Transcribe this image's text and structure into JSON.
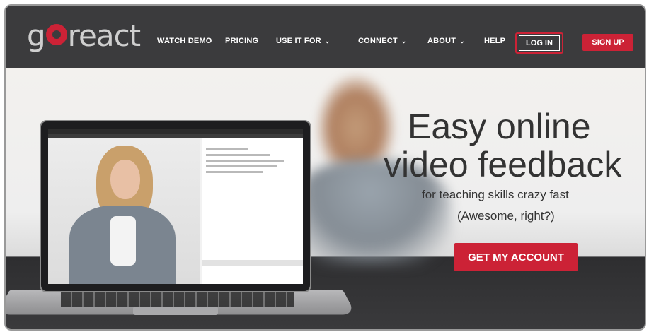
{
  "logo": {
    "pre": "g",
    "post": "react"
  },
  "nav": {
    "items": [
      {
        "label": "WATCH DEMO",
        "dropdown": false
      },
      {
        "label": "PRICING",
        "dropdown": false
      },
      {
        "label": "USE IT FOR",
        "dropdown": true
      },
      {
        "label": "CONNECT",
        "dropdown": true
      },
      {
        "label": "ABOUT",
        "dropdown": true
      },
      {
        "label": "HELP",
        "dropdown": false
      }
    ],
    "login_label": "LOG IN",
    "signup_label": "SIGN UP",
    "chevron": "⌄"
  },
  "hero": {
    "headline_line1": "Easy online",
    "headline_line2": "video feedback",
    "subtitle_line1": "for teaching skills crazy fast",
    "subtitle_line2": "(Awesome, right?)",
    "cta_label": "GET MY ACCOUNT"
  },
  "colors": {
    "brand": "#cc2236",
    "nav_bg": "#3b3b3d",
    "heading": "#333333"
  }
}
